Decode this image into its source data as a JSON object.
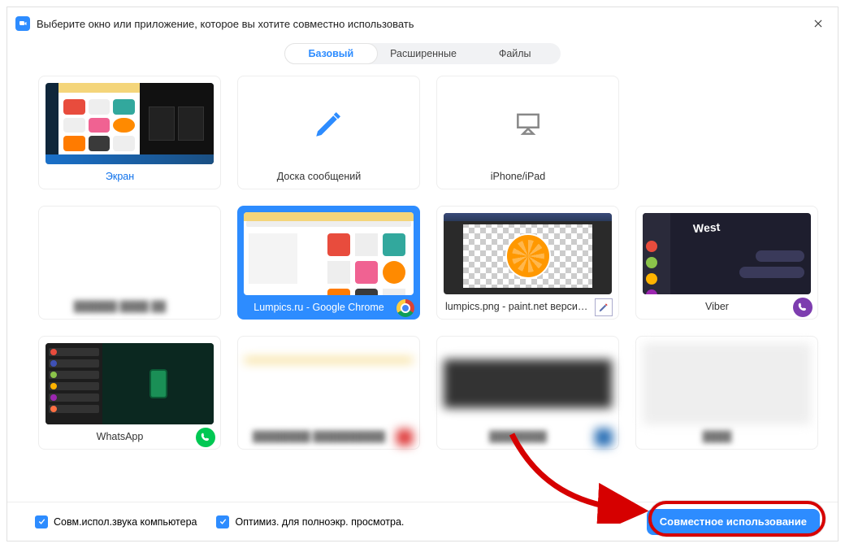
{
  "window": {
    "title": "Выберите окно или приложение, которое вы хотите совместно использовать"
  },
  "tabs": {
    "basic": "Базовый",
    "advanced": "Расширенные",
    "files": "Файлы"
  },
  "cards": {
    "screen": "Экран",
    "whiteboard": "Доска сообщений",
    "iphone": "iPhone/iPad",
    "hidden1": "",
    "chrome": "Lumpics.ru - Google Chrome",
    "paintnet": "lumpics.png - paint.net версия 4...",
    "viber": "Viber",
    "whatsapp": "WhatsApp",
    "hidden2": "",
    "hidden3": "",
    "hidden4": ""
  },
  "footer": {
    "shareAudio": "Совм.испол.звука компьютера",
    "optimize": "Оптимиз. для полноэкр. просмотра.",
    "shareButton": "Совместное использование"
  }
}
